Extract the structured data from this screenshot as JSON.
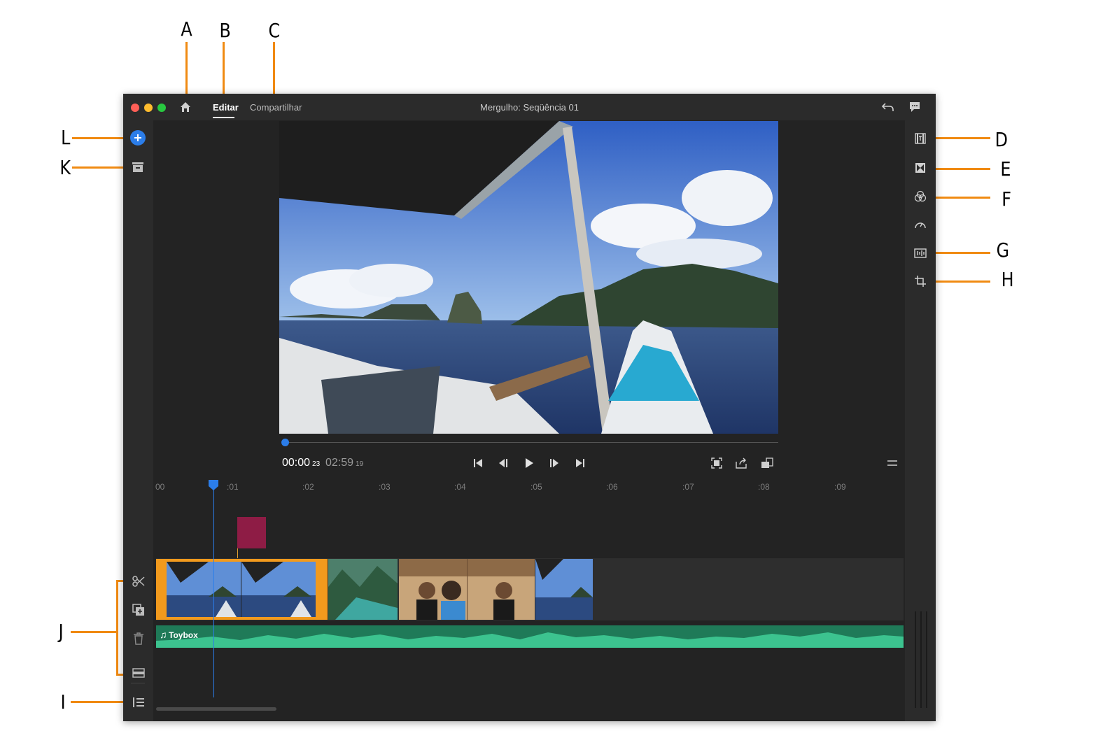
{
  "callouts": {
    "A": "A",
    "B": "B",
    "C": "C",
    "D": "D",
    "E": "E",
    "F": "F",
    "G": "G",
    "H": "H",
    "I": "I",
    "J": "J",
    "K": "K",
    "L": "L"
  },
  "titlebar": {
    "tabs": {
      "edit": "Editar",
      "share": "Compartilhar"
    },
    "document_title": "Mergulho: Seqüência 01"
  },
  "player": {
    "current_time": "00:00",
    "current_frames": "23",
    "duration_time": "02:59",
    "duration_frames": "19",
    "progress": 0.0
  },
  "timeline": {
    "ruler_ticks": [
      "00",
      ":01",
      ":02",
      ":03",
      ":04",
      ":05",
      ":06",
      ":07",
      ":08",
      ":09"
    ],
    "audio_clip_label": "Toybox"
  },
  "colors": {
    "accent_blue": "#2b7de9",
    "selection_orange": "#f29a1d",
    "title_clip": "#8e1c45",
    "audio_green": "#1f7a58",
    "callout_orange": "#f08a12"
  },
  "icons": {
    "left_rail": [
      "add-media-icon",
      "project-panel-icon",
      "split-clip-icon",
      "duplicate-icon",
      "delete-icon",
      "track-icon",
      "track-list-icon"
    ],
    "right_rail": [
      "titles-icon",
      "transitions-icon",
      "color-icon",
      "speed-icon",
      "audio-icon",
      "transform-crop-icon"
    ],
    "titlebar": [
      "home-icon",
      "undo-icon",
      "feedback-icon"
    ],
    "transport": [
      "go-to-start-icon",
      "step-back-icon",
      "play-icon",
      "step-forward-icon",
      "go-to-end-icon",
      "fit-icon",
      "export-frame-icon",
      "aspect-icon",
      "menu-icon"
    ]
  }
}
